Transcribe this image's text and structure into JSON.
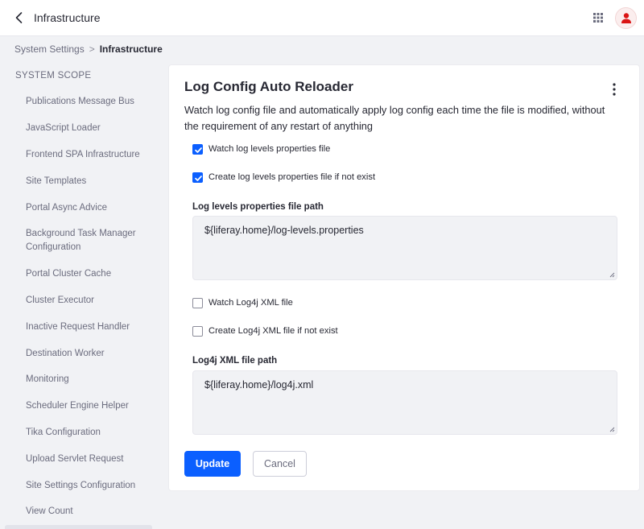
{
  "header": {
    "title": "Infrastructure",
    "back_icon": "chevron-left-icon",
    "apps_icon": "grid-icon",
    "avatar_icon": "user-icon"
  },
  "breadcrumb": {
    "parent": "System Settings",
    "separator": ">",
    "current": "Infrastructure"
  },
  "sidebar": {
    "scope_title": "SYSTEM SCOPE",
    "items": [
      "Publications Message Bus",
      "JavaScript Loader",
      "Frontend SPA Infrastructure",
      "Site Templates",
      "Portal Async Advice",
      "Background Task Manager Configuration",
      "Portal Cluster Cache",
      "Cluster Executor",
      "Inactive Request Handler",
      "Destination Worker",
      "Monitoring",
      "Scheduler Engine Helper",
      "Tika Configuration",
      "Upload Servlet Request",
      "Site Settings Configuration",
      "View Count"
    ]
  },
  "form": {
    "title": "Log Config Auto Reloader",
    "description": "Watch log config file and automatically apply log config each time the file is modified, without the requirement of any restart of anything",
    "watch_levels": {
      "label": "Watch log levels properties file",
      "checked": true
    },
    "create_levels": {
      "label": "Create log levels properties file if not exist",
      "checked": true
    },
    "levels_path": {
      "label": "Log levels properties file path",
      "value": "${liferay.home}/log-levels.properties"
    },
    "watch_log4j": {
      "label": "Watch Log4j XML file",
      "checked": false
    },
    "create_log4j": {
      "label": "Create Log4j XML file if not exist",
      "checked": false
    },
    "log4j_path": {
      "label": "Log4j XML file path",
      "value": "${liferay.home}/log4j.xml"
    },
    "update_label": "Update",
    "cancel_label": "Cancel"
  },
  "colors": {
    "primary": "#0b5fff",
    "avatar_icon": "#da1414"
  }
}
